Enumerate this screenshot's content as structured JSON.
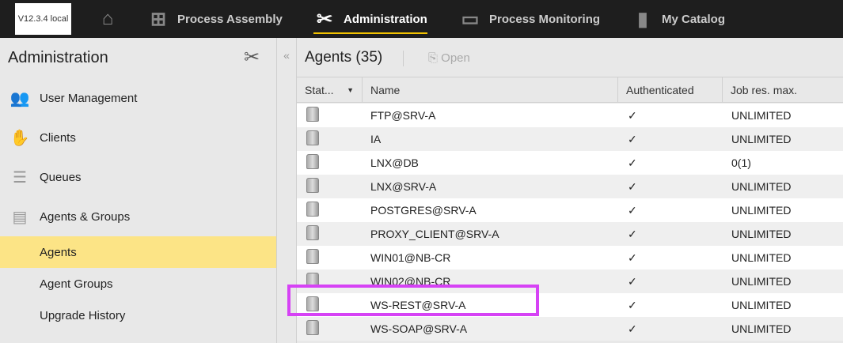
{
  "topbar": {
    "version": "V12.3.4 local",
    "nav": [
      {
        "label": "Process Assembly",
        "icon": "process-assembly-icon"
      },
      {
        "label": "Administration",
        "icon": "tools-icon",
        "active": true
      },
      {
        "label": "Process Monitoring",
        "icon": "monitor-icon"
      },
      {
        "label": "My Catalog",
        "icon": "book-icon"
      }
    ]
  },
  "sidebar": {
    "title": "Administration",
    "items": [
      {
        "label": "User Management",
        "icon": "users-icon"
      },
      {
        "label": "Clients",
        "icon": "handshake-icon"
      },
      {
        "label": "Queues",
        "icon": "queues-icon"
      },
      {
        "label": "Agents & Groups",
        "icon": "agents-icon"
      },
      {
        "label": "Agents",
        "selected": true
      },
      {
        "label": "Agent Groups"
      },
      {
        "label": "Upgrade History"
      }
    ]
  },
  "main": {
    "title": "Agents (35)",
    "open_label": "Open",
    "columns": [
      "Stat...",
      "Name",
      "Authenticated",
      "Job res. max."
    ],
    "rows": [
      {
        "name": "FTP@SRV-A",
        "auth": "✓",
        "job": "UNLIMITED"
      },
      {
        "name": "IA",
        "auth": "✓",
        "job": "UNLIMITED"
      },
      {
        "name": "LNX@DB",
        "auth": "✓",
        "job": "0(1)"
      },
      {
        "name": "LNX@SRV-A",
        "auth": "✓",
        "job": "UNLIMITED"
      },
      {
        "name": "POSTGRES@SRV-A",
        "auth": "✓",
        "job": "UNLIMITED"
      },
      {
        "name": "PROXY_CLIENT@SRV-A",
        "auth": "✓",
        "job": "UNLIMITED"
      },
      {
        "name": "WIN01@NB-CR",
        "auth": "✓",
        "job": "UNLIMITED"
      },
      {
        "name": "WIN02@NB-CR",
        "auth": "✓",
        "job": "UNLIMITED"
      },
      {
        "name": "WS-REST@SRV-A",
        "auth": "✓",
        "job": "UNLIMITED"
      },
      {
        "name": "WS-SOAP@SRV-A",
        "auth": "✓",
        "job": "UNLIMITED"
      }
    ]
  }
}
